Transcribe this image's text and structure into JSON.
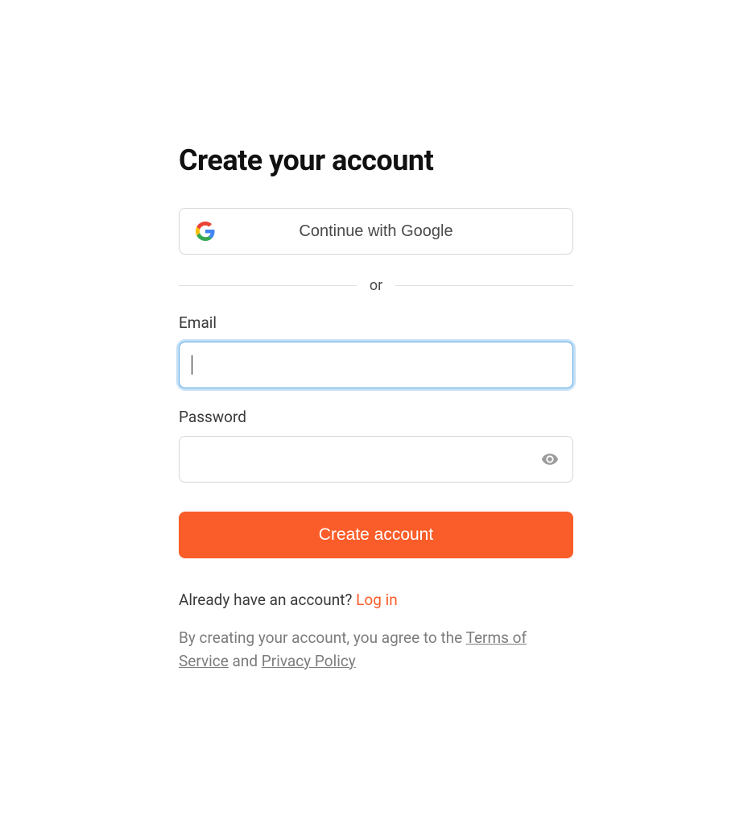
{
  "title": "Create your account",
  "google_button_label": "Continue with Google",
  "divider_text": "or",
  "email": {
    "label": "Email",
    "value": ""
  },
  "password": {
    "label": "Password",
    "value": ""
  },
  "create_button_label": "Create account",
  "login_prompt": "Already have an account? ",
  "login_link_label": "Log in",
  "legal": {
    "prefix": "By creating your account, you agree to the ",
    "terms_label": "Terms of Service",
    "mid": " and ",
    "privacy_label": "Privacy Policy"
  },
  "colors": {
    "accent": "#fa5d29",
    "focus": "#5ca9e6"
  }
}
